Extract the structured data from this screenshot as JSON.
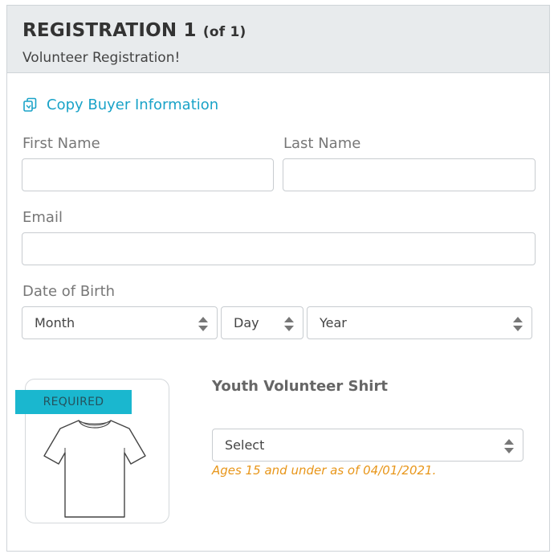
{
  "header": {
    "title": "REGISTRATION 1",
    "count": "(of 1)",
    "subtitle": "Volunteer Registration!"
  },
  "copy_buyer": {
    "label": "Copy Buyer Information",
    "icon": "copy-icon"
  },
  "fields": {
    "first_name": {
      "label": "First Name",
      "value": ""
    },
    "last_name": {
      "label": "Last Name",
      "value": ""
    },
    "email": {
      "label": "Email",
      "value": ""
    }
  },
  "dob": {
    "label": "Date of Birth",
    "month": "Month",
    "day": "Day",
    "year": "Year"
  },
  "shirt": {
    "badge": "REQUIRED",
    "title": "Youth Volunteer Shirt",
    "select": "Select",
    "note": "Ages 15 and under as of 04/01/2021."
  },
  "colors": {
    "accent": "#1aa3c8",
    "badge": "#1ab7cf",
    "note": "#e8961a",
    "header_bg": "#e8ebed"
  }
}
